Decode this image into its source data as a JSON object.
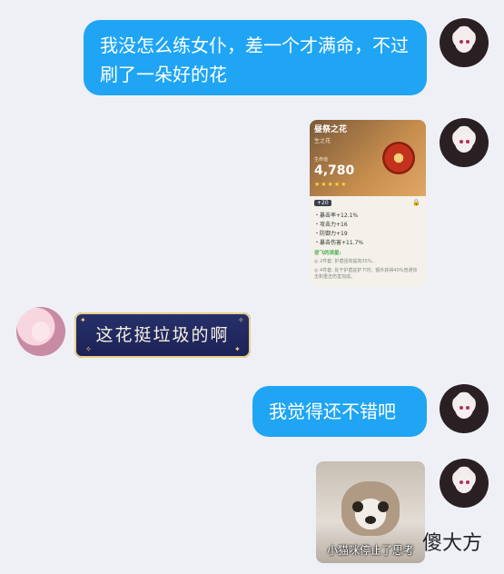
{
  "messages": {
    "m1_text": "我没怎么练女仆，差一个才满命，不过刷了一朵好的花",
    "m4_text": "我觉得还不错吧"
  },
  "artifact_card": {
    "name": "昼祭之花",
    "slot": "生之花",
    "main_stat_label": "生命值",
    "main_stat_value": "4,780",
    "stars": "★★★★★",
    "level": "+20",
    "substats": [
      "・暴击率+12.1%",
      "・攻击力+16",
      "・防御力+19",
      "・暴击伤害+11.7%"
    ],
    "set_name": "逆飞的流星:",
    "set_effect_2": "◎ 2件套: 护盾强效提高35%。",
    "set_effect_4": "◎ 4件套: 处于护盾庇护下时，额外获得40%普通攻击和重击伤害加成。"
  },
  "reply_image": {
    "text": "这花挺垃圾的啊"
  },
  "meme_image": {
    "caption": "小猫咪停止了思考"
  },
  "watermark": {
    "text": "傻大方"
  },
  "colors": {
    "bubble_blue": "#1fa5f4",
    "background": "#eef0f6"
  }
}
